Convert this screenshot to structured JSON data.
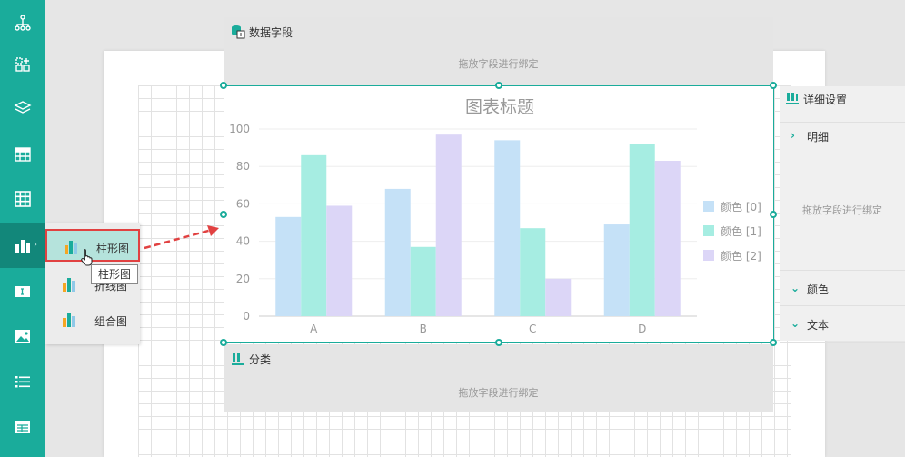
{
  "sidebar": {
    "icons": [
      "hierarchy-icon",
      "component-grid-icon",
      "layers-icon",
      "table-icon",
      "grid-table-icon",
      "bar-chart-icon",
      "textbox-icon",
      "image-icon",
      "list-icon",
      "report-icon"
    ],
    "active_index": 5,
    "expand_glyph": "›"
  },
  "flyout": {
    "items": [
      {
        "label": "柱形图"
      },
      {
        "label": "折线图"
      },
      {
        "label": "组合图"
      }
    ]
  },
  "tooltip": {
    "text": "柱形图"
  },
  "data_field_zone": {
    "title": "数据字段",
    "hint": "拖放字段进行绑定"
  },
  "category_zone": {
    "title": "分类",
    "hint": "拖放字段进行绑定"
  },
  "details_panel": {
    "title": "详细设置",
    "detail_label": "明细",
    "hint": "拖放字段进行绑定",
    "color_label": "颜色",
    "text_label": "文本"
  },
  "chart_data": {
    "type": "bar",
    "title": "图表标题",
    "categories": [
      "A",
      "B",
      "C",
      "D"
    ],
    "series": [
      {
        "name": "颜色 [0]",
        "values": [
          53,
          68,
          94,
          49
        ]
      },
      {
        "name": "颜色 [1]",
        "values": [
          86,
          37,
          47,
          92
        ]
      },
      {
        "name": "颜色 [2]",
        "values": [
          59,
          97,
          20,
          83
        ]
      }
    ],
    "ylim": [
      0,
      100
    ],
    "yticks": [
      0,
      20,
      40,
      60,
      80,
      100
    ],
    "grid": true,
    "legend": "right",
    "colors": [
      "#c5e1f7",
      "#a6ede2",
      "#dcd6f7"
    ]
  },
  "colors": {
    "accent": "#1aac9b",
    "highlight_border": "#e14141"
  }
}
